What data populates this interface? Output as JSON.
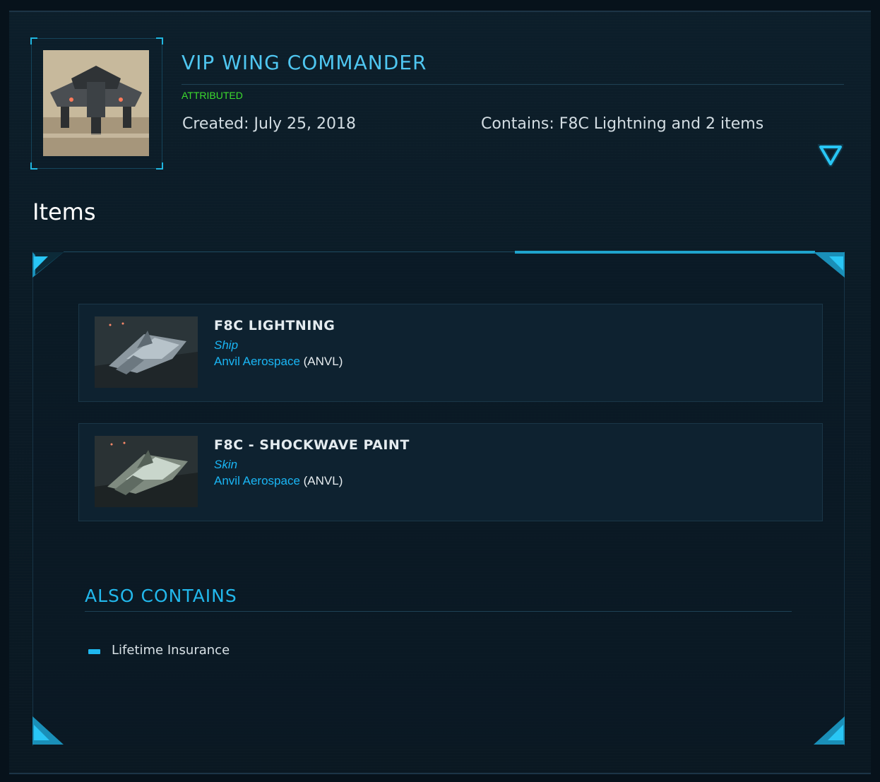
{
  "pledge": {
    "title": "VIP WING COMMANDER",
    "status": "ATTRIBUTED",
    "created": "Created: July 25, 2018",
    "contains": "Contains: F8C Lightning and 2 items",
    "toggle_icon": "chevron-down-triangle-icon"
  },
  "items_section": {
    "heading": "Items",
    "items": [
      {
        "name": "F8C LIGHTNING",
        "type": "Ship",
        "manufacturer": "Anvil Aerospace",
        "code": "(ANVL)"
      },
      {
        "name": "F8C - SHOCKWAVE PAINT",
        "type": "Skin",
        "manufacturer": "Anvil Aerospace",
        "code": "(ANVL)"
      }
    ]
  },
  "also_contains": {
    "heading": "ALSO CONTAINS",
    "items": [
      "Lifetime Insurance"
    ]
  },
  "colors": {
    "accent": "#1fb6e0",
    "title": "#4fc6f0",
    "status": "#3ddc2e",
    "link": "#1ab6f5"
  }
}
